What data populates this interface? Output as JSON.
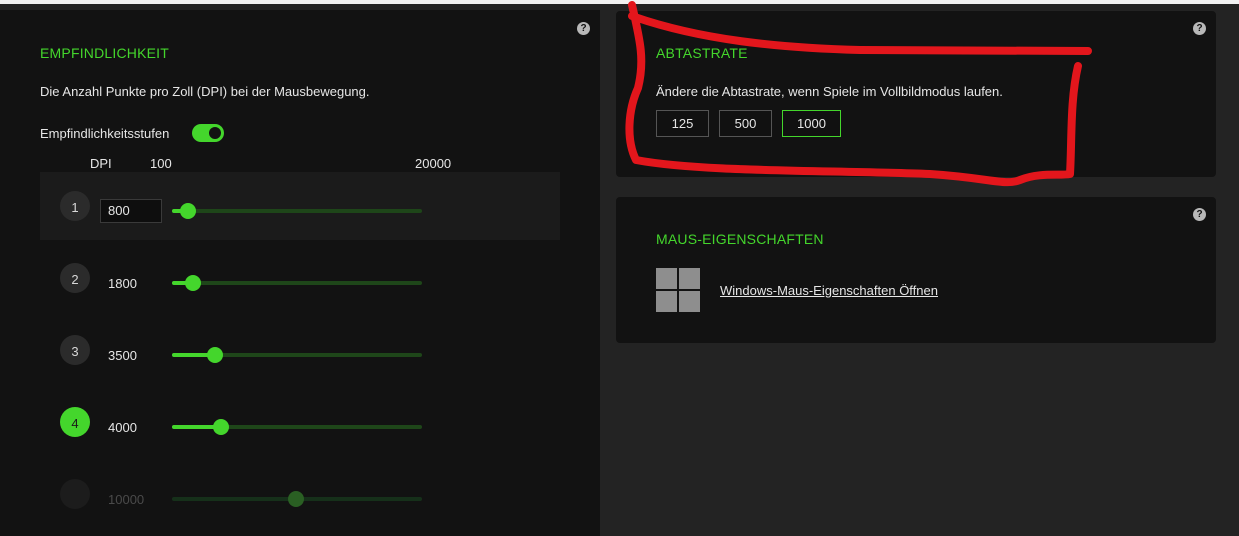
{
  "help_symbol": "?",
  "sensitivity": {
    "title": "EMPFINDLICHKEIT",
    "description": "Die Anzahl Punkte pro Zoll (DPI) bei der Mausbewegung.",
    "stages_label": "Empfindlichkeitsstufen",
    "stages_enabled": true,
    "dpi_label": "DPI",
    "range_min": "100",
    "range_max": "20000",
    "stages": [
      {
        "number": "1",
        "value": "800",
        "dpi": 800,
        "dot_color": "#e8232a",
        "active": true,
        "selected": false,
        "enabled": true
      },
      {
        "number": "2",
        "value": "1800",
        "dpi": 1800,
        "dot_color": "#44d62c",
        "active": false,
        "selected": false,
        "enabled": true
      },
      {
        "number": "3",
        "value": "3500",
        "dpi": 3500,
        "dot_color": "#2f6fe8",
        "active": false,
        "selected": false,
        "enabled": true
      },
      {
        "number": "4",
        "value": "4000",
        "dpi": 4000,
        "dot_color": "#2ed3e6",
        "active": false,
        "selected": true,
        "enabled": true
      },
      {
        "number": "",
        "value": "10000",
        "dpi": 10000,
        "dot_color": "",
        "active": false,
        "selected": false,
        "enabled": false
      }
    ]
  },
  "polling": {
    "title": "ABTASTRATE",
    "description": "Ändere die Abtastrate, wenn Spiele im Vollbildmodus laufen.",
    "options": [
      "125",
      "500",
      "1000"
    ],
    "selected": "1000"
  },
  "mouse_props": {
    "title": "MAUS-EIGENSCHAFTEN",
    "link": "Windows-Maus-Eigenschaften Öffnen"
  },
  "colors": {
    "accent": "#44d62c",
    "annotation": "#e3161c"
  }
}
